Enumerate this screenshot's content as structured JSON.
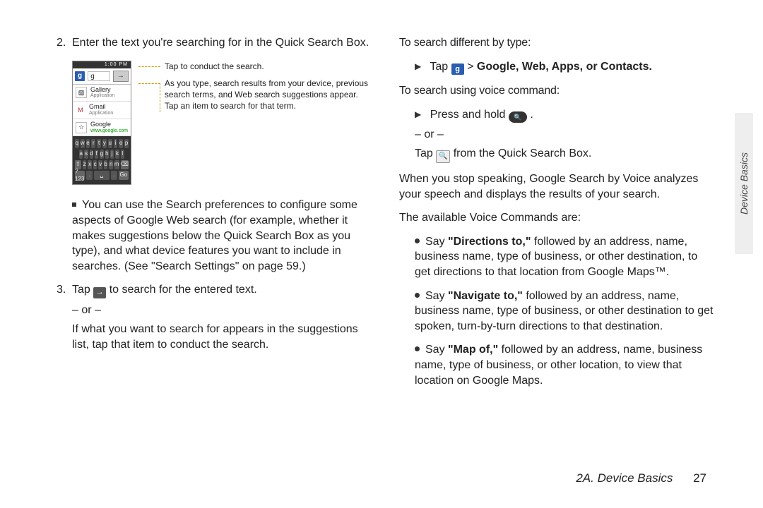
{
  "side_tab": "Device Basics",
  "footer": {
    "section": "2A. Device Basics",
    "page": "27"
  },
  "left": {
    "step2": {
      "n": "2.",
      "text": "Enter the text you're searching for in the Quick Search Box."
    },
    "figure": {
      "status_time": "1:00 PM",
      "search_letter": "g",
      "suggestions": [
        {
          "title": "Gallery",
          "sub": "Application"
        },
        {
          "title": "Gmail",
          "sub": "Application"
        },
        {
          "title": "Google",
          "sub": "www.google.com",
          "link": true
        }
      ],
      "keys_row1": [
        "q",
        "w",
        "e",
        "r",
        "t",
        "y",
        "u",
        "i",
        "o",
        "p"
      ],
      "keys_row2": [
        "a",
        "s",
        "d",
        "f",
        "g",
        "h",
        "j",
        "k",
        "l"
      ],
      "keys_row3": [
        "⇧",
        "z",
        "x",
        "c",
        "v",
        "b",
        "n",
        "m",
        "⌫"
      ],
      "keys_row4": [
        "?123",
        ".",
        "␣",
        ".",
        "Go"
      ],
      "annot1": "Tap to conduct the search.",
      "annot2": "As you type, search results from your device, previous search terms, and Web search suggestions appear. Tap an item to search for that term."
    },
    "square_note": "You can use the Search preferences to configure some aspects of Google Web search (for example, whether it makes suggestions below the Quick Search Box as you type), and what device features you want to include in searches. (See \"Search Settings\" on page 59.)",
    "step3": {
      "n": "3.",
      "pre": "Tap ",
      "post": " to search for the entered text.",
      "or": "– or –",
      "alt": "If what you want to search for appears in the suggestions list, tap that item to conduct the search."
    }
  },
  "right": {
    "heading1": "To search different by type:",
    "tri1_pre": "Tap ",
    "tri1_post": " Google, Web, Apps, or Contacts.",
    "gt": ">",
    "heading2": "To search using voice command:",
    "tri2_pre": "Press and hold ",
    "tri2_post": ".",
    "or": "– or –",
    "tri2_alt_pre": "Tap ",
    "tri2_alt_post": " from the Quick Search Box.",
    "para1": "When you stop speaking, Google Search by Voice analyzes your speech and displays the results of your search.",
    "para2": "The available Voice Commands are:",
    "bullets": [
      {
        "lead": "Say ",
        "b": "\"Directions to,\"",
        "tail": " followed by an address, name, business name, type of business, or other destination, to get directions to that location from Google Maps™."
      },
      {
        "lead": "Say ",
        "b": "\"Navigate to,\"",
        "tail": " followed by an address, name, business name, type of business, or other destination to get spoken, turn-by-turn directions to that destination."
      },
      {
        "lead": "Say ",
        "b": "\"Map of,\"",
        "tail": " followed by an address, name, business name, type of business, or other location, to view that location on Google Maps."
      }
    ]
  }
}
